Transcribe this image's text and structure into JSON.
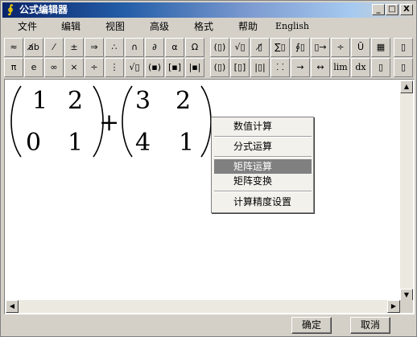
{
  "window": {
    "title": "公式编辑器"
  },
  "titlebar_buttons": {
    "minimize": "_",
    "maximize": "□",
    "close": "X"
  },
  "menu": [
    "文件",
    "编辑",
    "视图",
    "高级",
    "格式",
    "帮助",
    "English"
  ],
  "toolbar1": [
    "≈",
    "a̸b",
    "⁄",
    "±",
    "⇒",
    "∴",
    "∩",
    "∂",
    "α",
    "Ω",
    "(▯)",
    "√▯",
    "▯̸",
    "∑▯",
    "∮▯",
    "▯→",
    "÷",
    "Ū",
    "▦",
    "▯"
  ],
  "toolbar2": [
    "π",
    "e",
    "∞",
    "×",
    "÷",
    "⋮",
    "√▯",
    "(▪)",
    "[▪]",
    "|▪|",
    "(▯)",
    "[▯]",
    "|▯|",
    "⸬",
    "→",
    "↔",
    "lim",
    "dx",
    "▯",
    "▯"
  ],
  "formula": {
    "matrix_a": [
      [
        "1",
        "2"
      ],
      [
        "0",
        "1"
      ]
    ],
    "operator": "+",
    "matrix_b": [
      [
        "3",
        "2"
      ],
      [
        "4",
        "1"
      ]
    ]
  },
  "context_menu": {
    "items": [
      {
        "label": "数值计算",
        "selected": false
      },
      {
        "label": "分式运算",
        "selected": false
      },
      {
        "label": "矩阵运算",
        "selected": true
      },
      {
        "label": "矩阵变换",
        "selected": false
      },
      {
        "label": "计算精度设置",
        "selected": false
      }
    ]
  },
  "buttons": {
    "ok": "确定",
    "cancel": "取消"
  },
  "scroll_arrows": {
    "up": "▲",
    "down": "▼",
    "left": "◀",
    "right": "▶"
  }
}
